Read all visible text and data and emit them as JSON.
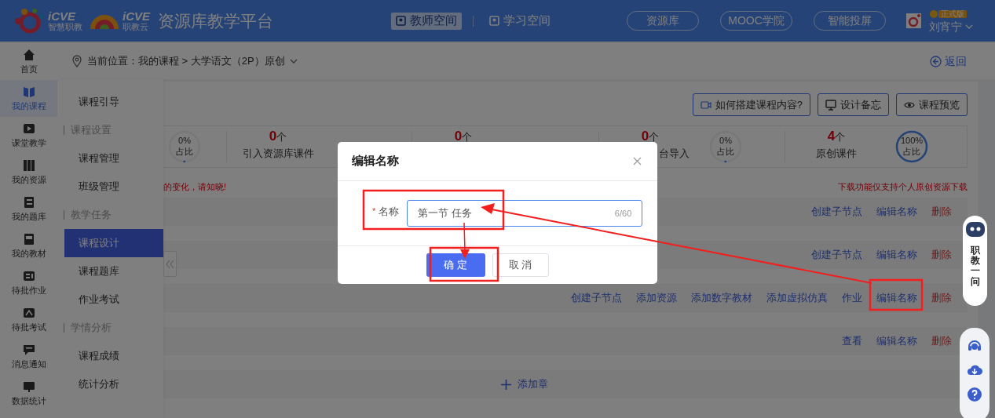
{
  "header": {
    "logo_1": {
      "mark": "iCVE",
      "sub": "智慧职教"
    },
    "logo_2": {
      "mark": "iCVE",
      "sub": "职教云"
    },
    "title": "资源库教学平台",
    "spaces": [
      {
        "label": "教师空间",
        "selected": true
      },
      {
        "label": "学习空间",
        "selected": false
      }
    ],
    "pills": [
      "资源库",
      "MOOC学院",
      "智能投屏"
    ],
    "badge": "正式版",
    "user": "刘宵宁"
  },
  "rail": [
    {
      "label": "首页",
      "selected": false
    },
    {
      "label": "我的课程",
      "selected": true
    },
    {
      "label": "课堂教学",
      "selected": false
    },
    {
      "label": "我的资源",
      "selected": false
    },
    {
      "label": "我的题库",
      "selected": false
    },
    {
      "label": "我的教材",
      "selected": false
    },
    {
      "label": "待批作业",
      "selected": false
    },
    {
      "label": "待批考试",
      "selected": false
    },
    {
      "label": "消息通知",
      "selected": false
    },
    {
      "label": "数据统计",
      "selected": false
    }
  ],
  "breadcrumb": {
    "prefix": "当前位置：",
    "path": "我的课程 > 大学语文（2P）原创",
    "back": "返回"
  },
  "submenu": [
    {
      "kind": "item",
      "label": "课程引导",
      "selected": false
    },
    {
      "kind": "section",
      "label": "课程设置"
    },
    {
      "kind": "item",
      "label": "课程管理",
      "selected": false
    },
    {
      "kind": "item",
      "label": "班级管理",
      "selected": false
    },
    {
      "kind": "section",
      "label": "教学任务"
    },
    {
      "kind": "item",
      "label": "课程设计",
      "selected": true
    },
    {
      "kind": "item",
      "label": "课程题库",
      "selected": false
    },
    {
      "kind": "item",
      "label": "作业考试",
      "selected": false
    },
    {
      "kind": "section",
      "label": "学情分析"
    },
    {
      "kind": "item",
      "label": "课程成绩",
      "selected": false
    },
    {
      "kind": "item",
      "label": "统计分析",
      "selected": false
    }
  ],
  "toolbar": [
    "如何搭建课程内容?",
    "设计备忘",
    "课程预览"
  ],
  "stats": [
    {
      "ring": {
        "percent": "0%",
        "caption": "占比",
        "level": 0
      }
    },
    {
      "count": "0",
      "unit": "个",
      "label": "引入资源库课件"
    },
    {
      "count": "0",
      "unit": "个"
    },
    {
      "count": "0",
      "unit": "个",
      "label": "台导入",
      "ring": {
        "percent": "0%",
        "caption": "占比",
        "level": 0
      }
    },
    {
      "count": "4",
      "unit": "个",
      "label": "原创课件",
      "ring": {
        "percent": "100%",
        "caption": "占比",
        "level": 1
      }
    }
  ],
  "notice_left": "的变化，请知晓!",
  "notice_right": "下载功能仅支持个人原创资源下载",
  "rows": [
    {
      "actions": [
        {
          "label": "创建子节点",
          "kind": "link"
        },
        {
          "label": "编辑名称",
          "kind": "link"
        },
        {
          "label": "删除",
          "kind": "danger"
        }
      ]
    },
    {
      "actions": [
        {
          "label": "创建子节点",
          "kind": "link"
        },
        {
          "label": "编辑名称",
          "kind": "link"
        },
        {
          "label": "删除",
          "kind": "danger"
        }
      ]
    },
    {
      "actions": [
        {
          "label": "创建子节点",
          "kind": "link"
        },
        {
          "label": "添加资源",
          "kind": "link"
        },
        {
          "label": "添加数字教材",
          "kind": "link"
        },
        {
          "label": "添加虚拟仿真",
          "kind": "link"
        },
        {
          "label": "作业",
          "kind": "link"
        },
        {
          "label": "编辑名称",
          "kind": "link"
        },
        {
          "label": "删除",
          "kind": "danger"
        }
      ]
    },
    {
      "actions": [
        {
          "label": "查看",
          "kind": "link"
        },
        {
          "label": "编辑名称",
          "kind": "link"
        },
        {
          "label": "删除",
          "kind": "danger"
        }
      ]
    }
  ],
  "add_chapter": "添加章",
  "dialog": {
    "title": "编辑名称",
    "required_mark": "*",
    "field_label": "名称",
    "value": "第一节 任务",
    "counter": "6/60",
    "buttons": [
      {
        "label": "确 定",
        "kind": "primary"
      },
      {
        "label": "取 消",
        "kind": "default"
      }
    ]
  },
  "assistant": "职教一问"
}
